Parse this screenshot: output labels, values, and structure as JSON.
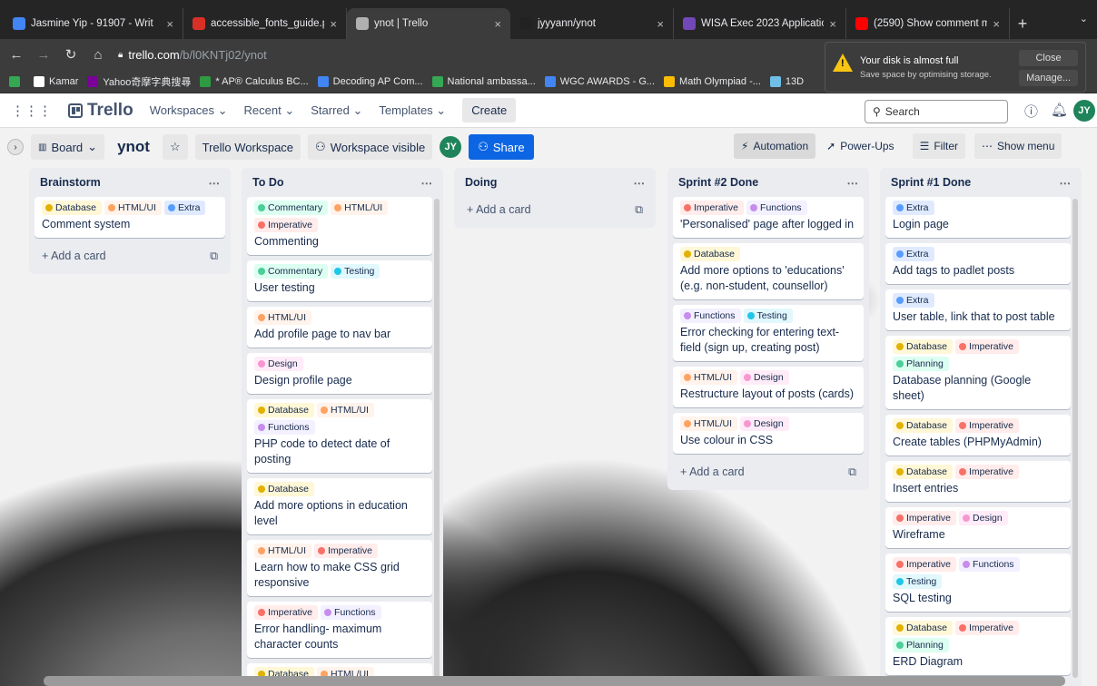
{
  "browser": {
    "tabs": [
      {
        "label": "Jasmine Yip - 91907 - Writ",
        "icon_color": "#4285f4",
        "icon": "docs-icon"
      },
      {
        "label": "accessible_fonts_guide.pdf",
        "icon_color": "#d93025",
        "icon": "pdf-icon"
      },
      {
        "label": "ynot | Trello",
        "icon_color": "#b0b0b0",
        "icon": "trello-icon"
      },
      {
        "label": "jyyyann/ynot",
        "icon_color": "#222222",
        "icon": "github-icon"
      },
      {
        "label": "WISA Exec 2023 Applicatio",
        "icon_color": "#7248b9",
        "icon": "forms-icon"
      },
      {
        "label": "(2590) Show comment me",
        "icon_color": "#ff0000",
        "icon": "youtube-icon"
      }
    ],
    "url": {
      "host": "trello.com",
      "path": "/b/l0KNTj02/ynot"
    },
    "bookmarks": [
      {
        "label": "",
        "color": "#34a853"
      },
      {
        "label": "Kamar",
        "color": "#ffffff"
      },
      {
        "label": "Yahoo奇摩字典搜尋",
        "color": "#7b0099"
      },
      {
        "label": "* AP® Calculus BC...",
        "color": "#2e9b43"
      },
      {
        "label": "Decoding AP Com...",
        "color": "#4285f4"
      },
      {
        "label": "National ambassa...",
        "color": "#34a853"
      },
      {
        "label": "WGC AWARDS - G...",
        "color": "#4285f4"
      },
      {
        "label": "Math Olympiad -...",
        "color": "#fbbc04"
      },
      {
        "label": "13D",
        "color": "#6fbfe8"
      }
    ],
    "disk_popup": {
      "title": "Your disk is almost full",
      "body": "Save space by optimising storage.",
      "close": "Close",
      "manage": "Manage..."
    }
  },
  "trello": {
    "nav": {
      "workspaces": "Workspaces",
      "recent": "Recent",
      "starred": "Starred",
      "templates": "Templates",
      "create": "Create",
      "search": "Search",
      "avatar": "JY",
      "logo": "Trello"
    },
    "boardbar": {
      "board_view": "Board",
      "title": "ynot",
      "workspace": "Trello Workspace",
      "visibility": "Workspace visible",
      "share": "Share",
      "automation": "Automation",
      "powerups": "Power-Ups",
      "filter": "Filter",
      "show_menu": "Show menu",
      "avatar": "JY"
    },
    "add_card": "+ Add a card",
    "label_colors": {
      "Database": {
        "dot": "#e2b203",
        "bg": "#fff7d6"
      },
      "HTML/UI": {
        "dot": "#fea362",
        "bg": "#fff3eb"
      },
      "Extra": {
        "dot": "#579dff",
        "bg": "#dfeaff"
      },
      "Commentary": {
        "dot": "#4bce97",
        "bg": "#dcfff1"
      },
      "Imperative": {
        "dot": "#f87168",
        "bg": "#ffeceb"
      },
      "Testing": {
        "dot": "#1fc7e6",
        "bg": "#e1f8fd"
      },
      "Design": {
        "dot": "#f797d2",
        "bg": "#ffecf8"
      },
      "Functions": {
        "dot": "#c68ded",
        "bg": "#f3f0ff"
      },
      "Planning": {
        "dot": "#4bce97",
        "bg": "#dcfff1"
      }
    },
    "lists": [
      {
        "title": "Brainstorm",
        "cards": [
          {
            "labels": [
              "Database",
              "HTML/UI",
              "Extra"
            ],
            "title": "Comment system"
          }
        ]
      },
      {
        "title": "To Do",
        "cards": [
          {
            "labels": [
              "Commentary",
              "HTML/UI",
              "Imperative"
            ],
            "title": "Commenting"
          },
          {
            "labels": [
              "Commentary",
              "Testing"
            ],
            "title": "User testing"
          },
          {
            "labels": [
              "HTML/UI"
            ],
            "title": "Add profile page to nav bar"
          },
          {
            "labels": [
              "Design"
            ],
            "title": "Design profile page"
          },
          {
            "labels": [
              "Database",
              "HTML/UI",
              "Functions"
            ],
            "title": "PHP code to detect date of posting"
          },
          {
            "labels": [
              "Database"
            ],
            "title": "Add more options in education level"
          },
          {
            "labels": [
              "HTML/UI",
              "Imperative"
            ],
            "title": "Learn how to make CSS grid responsive"
          },
          {
            "labels": [
              "Imperative",
              "Functions"
            ],
            "title": "Error handling- maximum character counts"
          },
          {
            "labels": [
              "Database",
              "HTML/UI"
            ],
            "title": ""
          }
        ]
      },
      {
        "title": "Doing",
        "cards": []
      },
      {
        "title": "Sprint #2 Done",
        "cards": [
          {
            "labels": [
              "Imperative",
              "Functions"
            ],
            "title": "'Personalised' page after logged in"
          },
          {
            "labels": [
              "Database"
            ],
            "title": "Add more options to 'educations' (e.g. non-student, counsellor)"
          },
          {
            "labels": [
              "Functions",
              "Testing"
            ],
            "title": "Error checking for entering text-field (sign up, creating post)"
          },
          {
            "labels": [
              "HTML/UI",
              "Design"
            ],
            "title": "Restructure layout of posts (cards)"
          },
          {
            "labels": [
              "HTML/UI",
              "Design"
            ],
            "title": "Use colour in CSS"
          }
        ]
      },
      {
        "title": "Sprint #1 Done",
        "cards": [
          {
            "labels": [
              "Extra"
            ],
            "title": "Login page"
          },
          {
            "labels": [
              "Extra"
            ],
            "title": "Add tags to padlet posts"
          },
          {
            "labels": [
              "Extra"
            ],
            "title": "User table, link that to post table"
          },
          {
            "labels": [
              "Database",
              "Imperative",
              "Planning"
            ],
            "title": "Database planning (Google sheet)"
          },
          {
            "labels": [
              "Database",
              "Imperative"
            ],
            "title": "Create tables (PHPMyAdmin)"
          },
          {
            "labels": [
              "Database",
              "Imperative"
            ],
            "title": "Insert entries"
          },
          {
            "labels": [
              "Imperative",
              "Design"
            ],
            "title": "Wireframe"
          },
          {
            "labels": [
              "Imperative",
              "Functions",
              "Testing"
            ],
            "title": "SQL testing"
          },
          {
            "labels": [
              "Database",
              "Imperative",
              "Planning"
            ],
            "title": "ERD Diagram"
          }
        ]
      }
    ]
  }
}
